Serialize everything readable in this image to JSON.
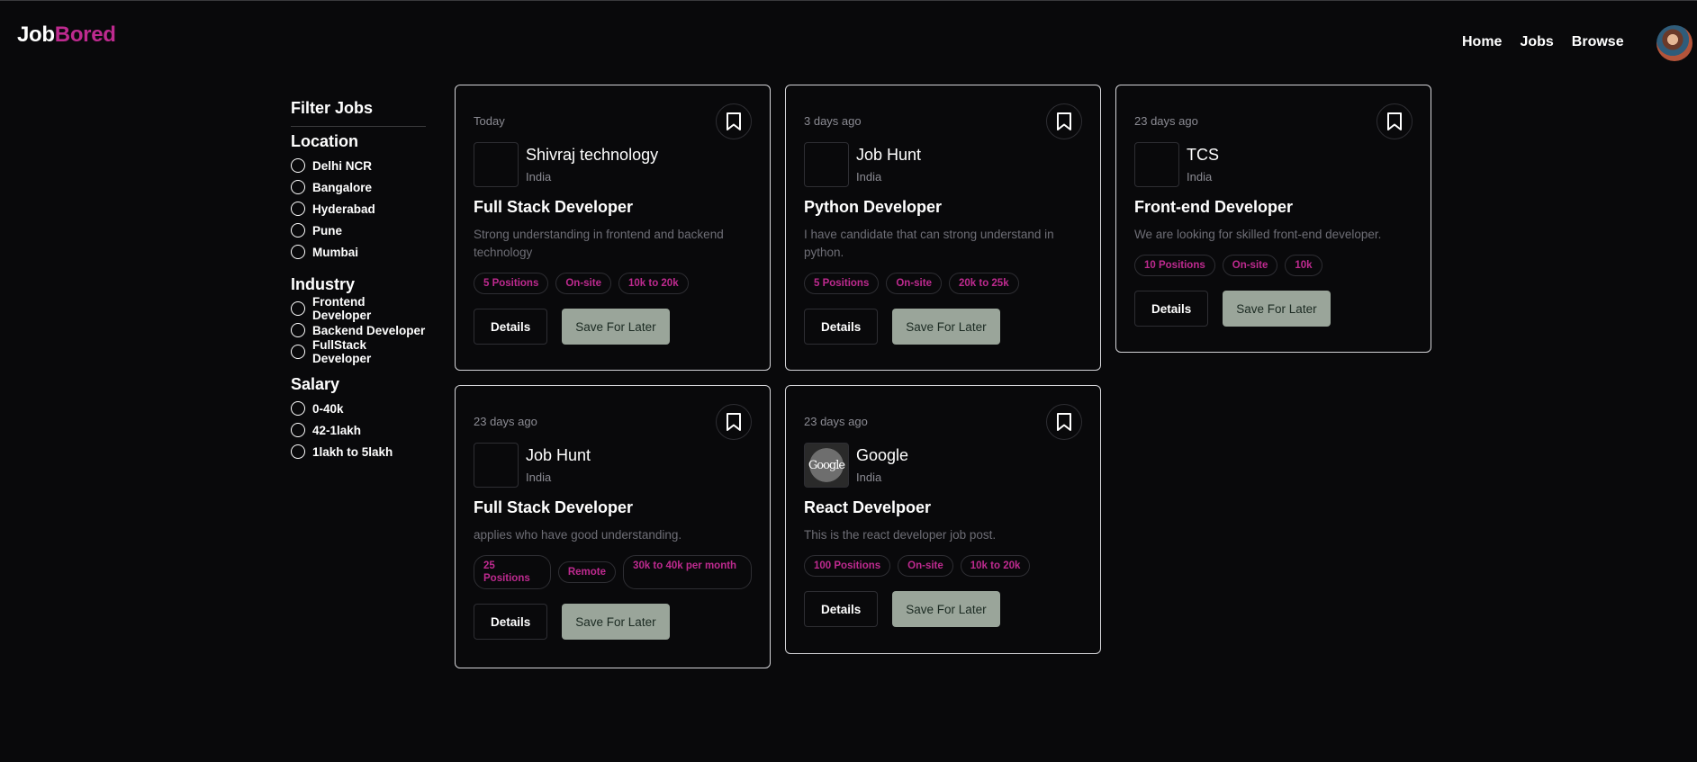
{
  "brand": {
    "part1": "Job",
    "part2": "Bored"
  },
  "nav": {
    "home": "Home",
    "jobs": "Jobs",
    "browse": "Browse"
  },
  "sidebar": {
    "title": "Filter Jobs",
    "groups": [
      {
        "title": "Location",
        "options": [
          "Delhi NCR",
          "Bangalore",
          "Hyderabad",
          "Pune",
          "Mumbai"
        ]
      },
      {
        "title": "Industry",
        "options": [
          "Frontend Developer",
          "Backend Developer",
          "FullStack Developer"
        ]
      },
      {
        "title": "Salary",
        "options": [
          "0-40k",
          "42-1lakh",
          "1lakh to 5lakh"
        ]
      }
    ]
  },
  "buttons": {
    "details": "Details",
    "save": "Save For Later"
  },
  "jobs": [
    {
      "date": "Today",
      "company": "Shivraj technology",
      "location": "India",
      "title": "Full Stack Developer",
      "description": "Strong understanding in frontend and backend technology",
      "positions": "5 Positions",
      "type": "On-site",
      "salary": "10k to 20k"
    },
    {
      "date": "3 days ago",
      "company": "Job Hunt",
      "location": "India",
      "title": "Python Developer",
      "description": "I have candidate that can strong understand in python.",
      "positions": "5 Positions",
      "type": "On-site",
      "salary": "20k to 25k"
    },
    {
      "date": "23 days ago",
      "company": "TCS",
      "location": "India",
      "title": "Front-end Developer",
      "description": "We are looking for skilled front-end developer.",
      "positions": "10 Positions",
      "type": "On-site",
      "salary": "10k"
    },
    {
      "date": "23 days ago",
      "company": "Job Hunt",
      "location": "India",
      "title": "Full Stack Developer",
      "description": "applies who have good understanding.",
      "positions": "25 Positions",
      "type": "Remote",
      "salary": "30k to 40k per month"
    },
    {
      "date": "23 days ago",
      "company": "Google",
      "location": "India",
      "title": "React Develpoer",
      "description": "This is the react developer job post.",
      "positions": "100 Positions",
      "type": "On-site",
      "salary": "10k to 20k",
      "logo_text": "Google"
    }
  ],
  "colors": {
    "accent": "#be2a8f",
    "background": "#09090b",
    "save_button": "#9aa59a"
  }
}
